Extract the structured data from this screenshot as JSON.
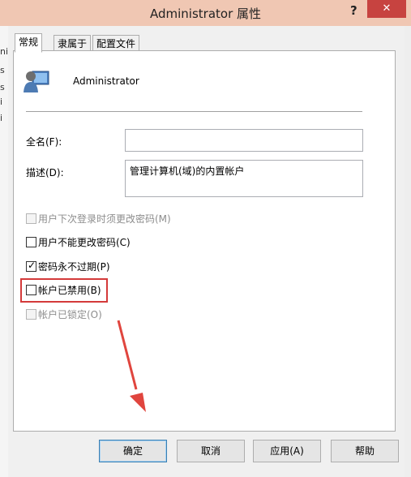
{
  "window": {
    "title": "Administrator 属性",
    "help": "?",
    "close": "✕"
  },
  "tabs": [
    {
      "label": "常规"
    },
    {
      "label": "隶属于"
    },
    {
      "label": "配置文件"
    }
  ],
  "user": {
    "name": "Administrator"
  },
  "fields": {
    "fullname_label": "全名(F):",
    "fullname_value": "",
    "description_label": "描述(D):",
    "description_value": "管理计算机(域)的内置帐户"
  },
  "options": [
    {
      "label": "用户下次登录时须更改密码(M)",
      "checked": false,
      "disabled": true
    },
    {
      "label": "用户不能更改密码(C)",
      "checked": false,
      "disabled": false
    },
    {
      "label": "密码永不过期(P)",
      "checked": true,
      "disabled": false
    },
    {
      "label": "帐户已禁用(B)",
      "checked": false,
      "disabled": false
    },
    {
      "label": "帐户已锁定(O)",
      "checked": false,
      "disabled": true
    }
  ],
  "buttons": {
    "ok": "确定",
    "cancel": "取消",
    "apply": "应用(A)",
    "help": "帮助"
  },
  "colors": {
    "highlight": "#d43a3a",
    "arrow": "#e0453e",
    "close_button": "#c74340"
  }
}
